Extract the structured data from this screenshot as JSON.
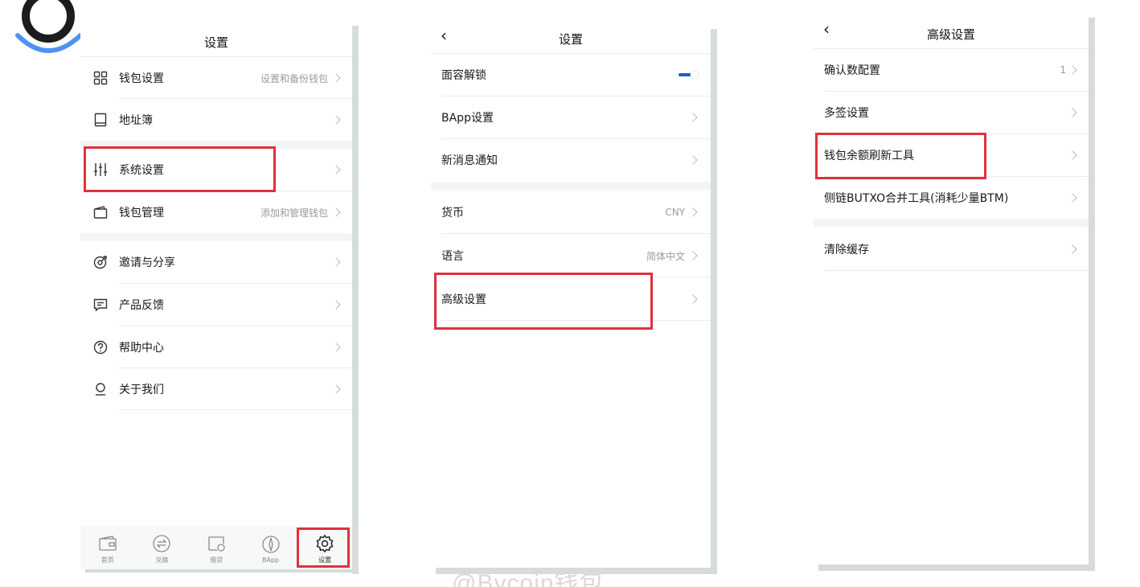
{
  "colors": {
    "highlight": "#e0313c",
    "accent": "#1a5fc8",
    "divider": "#ececec",
    "muted": "#9a9a9a"
  },
  "screen1": {
    "title": "设置",
    "items": [
      {
        "icon": "grid-icon",
        "label": "钱包设置",
        "value": "设置和备份钱包"
      },
      {
        "icon": "book-icon",
        "label": "地址簿",
        "value": ""
      },
      {
        "icon": "sliders-icon",
        "label": "系统设置",
        "value": ""
      },
      {
        "icon": "wallet-icon",
        "label": "钱包管理",
        "value": "添加和管理钱包"
      },
      {
        "icon": "share-icon",
        "label": "邀请与分享",
        "value": ""
      },
      {
        "icon": "chat-icon",
        "label": "产品反馈",
        "value": ""
      },
      {
        "icon": "help-icon",
        "label": "帮助中心",
        "value": ""
      },
      {
        "icon": "user-icon",
        "label": "关于我们",
        "value": ""
      }
    ],
    "tabs": [
      {
        "icon": "home-icon",
        "label": "首页"
      },
      {
        "icon": "exchange-icon",
        "label": "兑换"
      },
      {
        "icon": "loan-icon",
        "label": "借贷"
      },
      {
        "icon": "compass-icon",
        "label": "BApp"
      },
      {
        "icon": "gear-icon",
        "label": "设置"
      }
    ]
  },
  "screen2": {
    "title": "设置",
    "items": [
      {
        "label": "面容解锁",
        "value": ""
      },
      {
        "label": "BApp设置",
        "value": ""
      },
      {
        "label": "新消息通知",
        "value": ""
      },
      {
        "label": "货币",
        "value": "CNY"
      },
      {
        "label": "语言",
        "value": "简体中文"
      },
      {
        "label": "高级设置",
        "value": ""
      }
    ]
  },
  "screen3": {
    "title": "高级设置",
    "items": [
      {
        "label": "确认数配置",
        "value": "1"
      },
      {
        "label": "多签设置",
        "value": ""
      },
      {
        "label": "钱包余额刷新工具",
        "value": ""
      },
      {
        "label": "侧链BUTXO合并工具(消耗少量BTM)",
        "value": ""
      },
      {
        "label": "清除缓存",
        "value": ""
      }
    ]
  },
  "watermark": "@Bycoin钱包"
}
